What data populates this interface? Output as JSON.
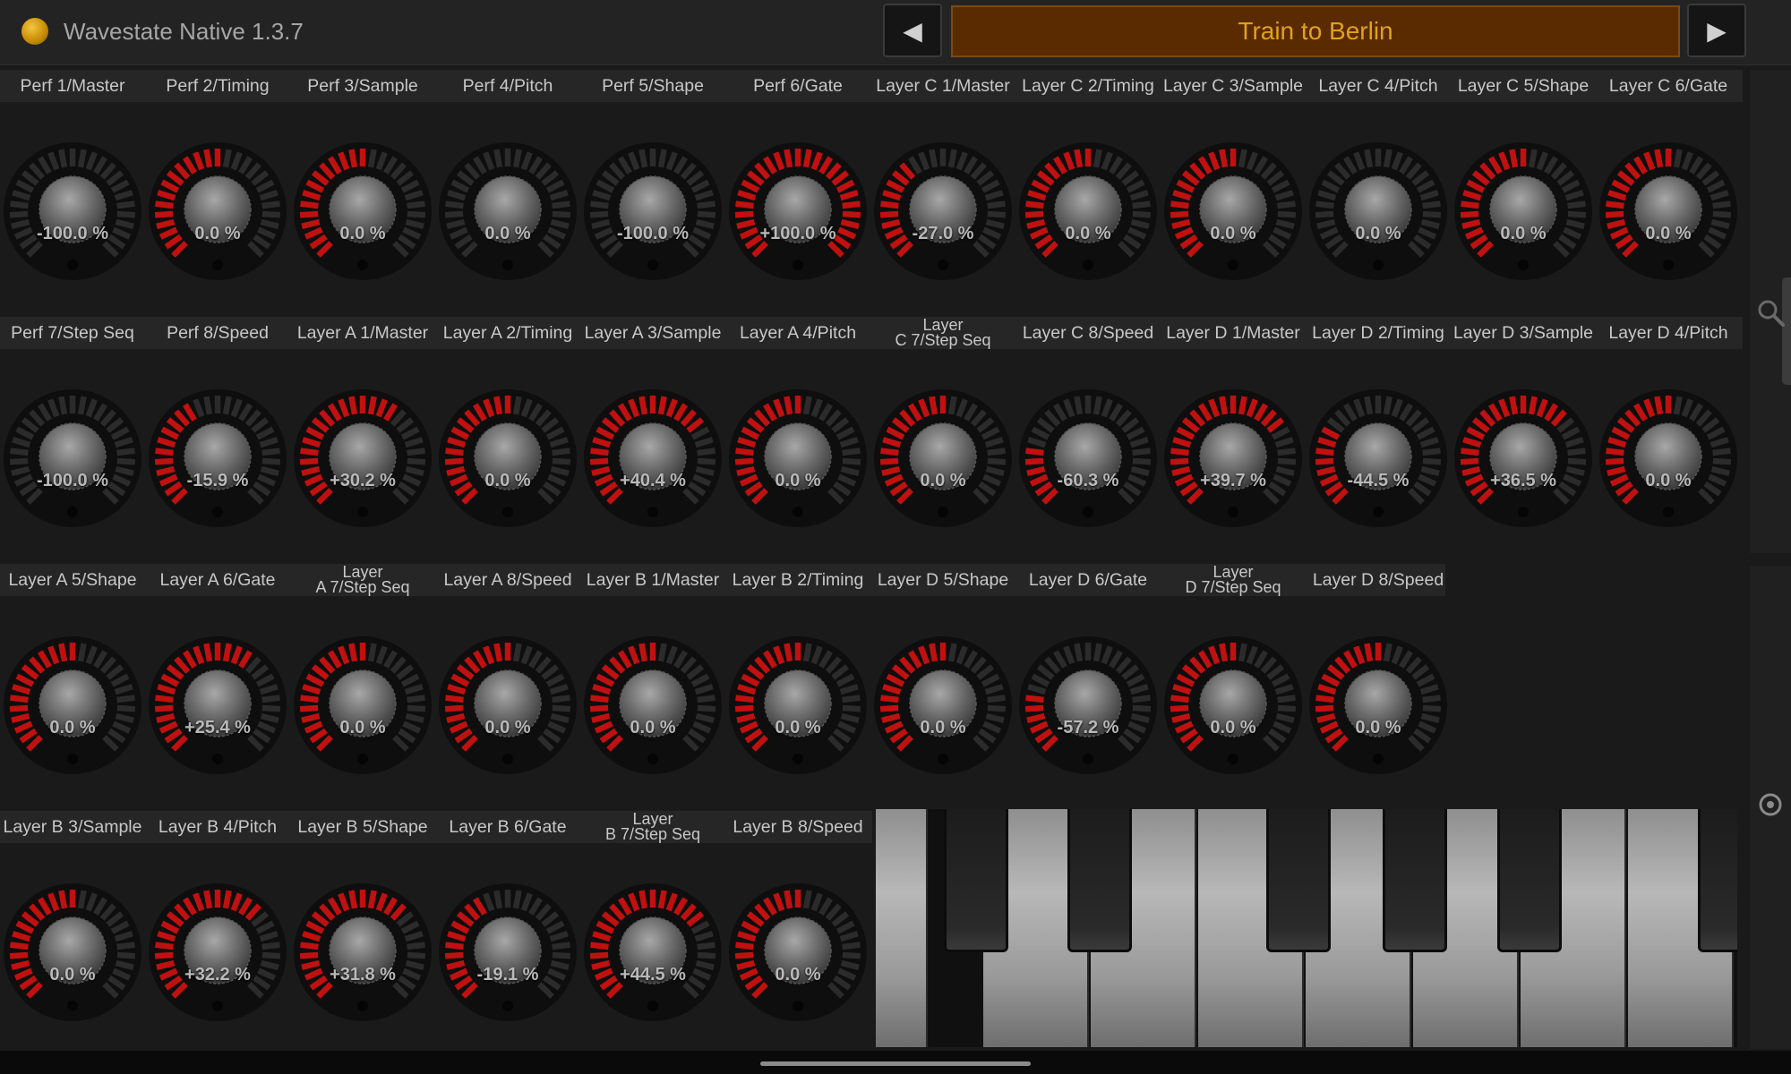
{
  "app": {
    "title": "Wavestate Native 1.3.7"
  },
  "nav": {
    "prev_glyph": "◀",
    "next_glyph": "▶",
    "preset_name": "Train to Berlin"
  },
  "colors": {
    "accent_red": "#c01010",
    "preset_bg": "#5a2a00",
    "preset_text": "#e0a21a",
    "led": "#e1a500"
  },
  "icons": {
    "search": "search-icon",
    "target": "target-icon"
  },
  "rows": [
    [
      {
        "label": "Perf 1/Master",
        "value": "-100.0 %",
        "level": 0
      },
      {
        "label": "Perf 2/Timing",
        "value": "0.0 %",
        "level": 0.5
      },
      {
        "label": "Perf 3/Sample",
        "value": "0.0 %",
        "level": 0.5
      },
      {
        "label": "Perf 4/Pitch",
        "value": "0.0 %",
        "level": 0
      },
      {
        "label": "Perf 5/Shape",
        "value": "-100.0 %",
        "level": 0
      },
      {
        "label": "Perf 6/Gate",
        "value": "+100.0 %",
        "level": 1
      },
      {
        "label": "Layer C 1/Master",
        "value": "-27.0 %",
        "level": 0.365
      },
      {
        "label": "Layer C 2/Timing",
        "value": "0.0 %",
        "level": 0.5
      },
      {
        "label": "Layer C 3/Sample",
        "value": "0.0 %",
        "level": 0.5
      },
      {
        "label": "Layer C 4/Pitch",
        "value": "0.0 %",
        "level": 0
      },
      {
        "label": "Layer C 5/Shape",
        "value": "0.0 %",
        "level": 0.5
      },
      {
        "label": "Layer C 6/Gate",
        "value": "0.0 %",
        "level": 0.5
      }
    ],
    [
      {
        "label": "Perf 7/Step Seq",
        "value": "-100.0 %",
        "level": 0
      },
      {
        "label": "Perf 8/Speed",
        "value": "-15.9 %",
        "level": 0.42
      },
      {
        "label": "Layer A 1/Master",
        "value": "+30.2 %",
        "level": 0.651
      },
      {
        "label": "Layer A 2/Timing",
        "value": "0.0 %",
        "level": 0.5
      },
      {
        "label": "Layer A 3/Sample",
        "value": "+40.4 %",
        "level": 0.702
      },
      {
        "label": "Layer A 4/Pitch",
        "value": "0.0 %",
        "level": 0.5
      },
      {
        "label": "Layer C 7/Step Seq",
        "label_l1": "Layer",
        "label_l2": "C 7/Step Seq",
        "value": "0.0 %",
        "level": 0.5
      },
      {
        "label": "Layer C 8/Speed",
        "value": "-60.3 %",
        "level": 0.2
      },
      {
        "label": "Layer D 1/Master",
        "value": "+39.7 %",
        "level": 0.699
      },
      {
        "label": "Layer D 2/Timing",
        "value": "-44.5 %",
        "level": 0.278
      },
      {
        "label": "Layer D 3/Sample",
        "value": "+36.5 %",
        "level": 0.683
      },
      {
        "label": "Layer D 4/Pitch",
        "value": "0.0 %",
        "level": 0.5
      }
    ],
    [
      {
        "label": "Layer A 5/Shape",
        "value": "0.0 %",
        "level": 0.5
      },
      {
        "label": "Layer A 6/Gate",
        "value": "+25.4 %",
        "level": 0.627
      },
      {
        "label": "Layer A 7/Step Seq",
        "label_l1": "Layer",
        "label_l2": "A 7/Step Seq",
        "value": "0.0 %",
        "level": 0.5
      },
      {
        "label": "Layer A 8/Speed",
        "value": "0.0 %",
        "level": 0.5
      },
      {
        "label": "Layer B 1/Master",
        "value": "0.0 %",
        "level": 0.5
      },
      {
        "label": "Layer B 2/Timing",
        "value": "0.0 %",
        "level": 0.5
      },
      {
        "label": "Layer D 5/Shape",
        "value": "0.0 %",
        "level": 0.5
      },
      {
        "label": "Layer D 6/Gate",
        "value": "-57.2 %",
        "level": 0.214
      },
      {
        "label": "Layer D 7/Step Seq",
        "label_l1": "Layer",
        "label_l2": "D 7/Step Seq",
        "value": "0.0 %",
        "level": 0.5
      },
      {
        "label": "Layer D 8/Speed",
        "value": "0.0 %",
        "level": 0.5
      }
    ],
    [
      {
        "label": "Layer B 3/Sample",
        "value": "0.0 %",
        "level": 0.5
      },
      {
        "label": "Layer B 4/Pitch",
        "value": "+32.2 %",
        "level": 0.661
      },
      {
        "label": "Layer B 5/Shape",
        "value": "+31.8 %",
        "level": 0.659
      },
      {
        "label": "Layer B 6/Gate",
        "value": "-19.1 %",
        "level": 0.405
      },
      {
        "label": "Layer B 7/Step Seq",
        "label_l1": "Layer",
        "label_l2": "B 7/Step Seq",
        "value": "+44.5 %",
        "level": 0.723
      },
      {
        "label": "Layer B 8/Speed",
        "value": "0.0 %",
        "level": 0.5
      }
    ]
  ]
}
